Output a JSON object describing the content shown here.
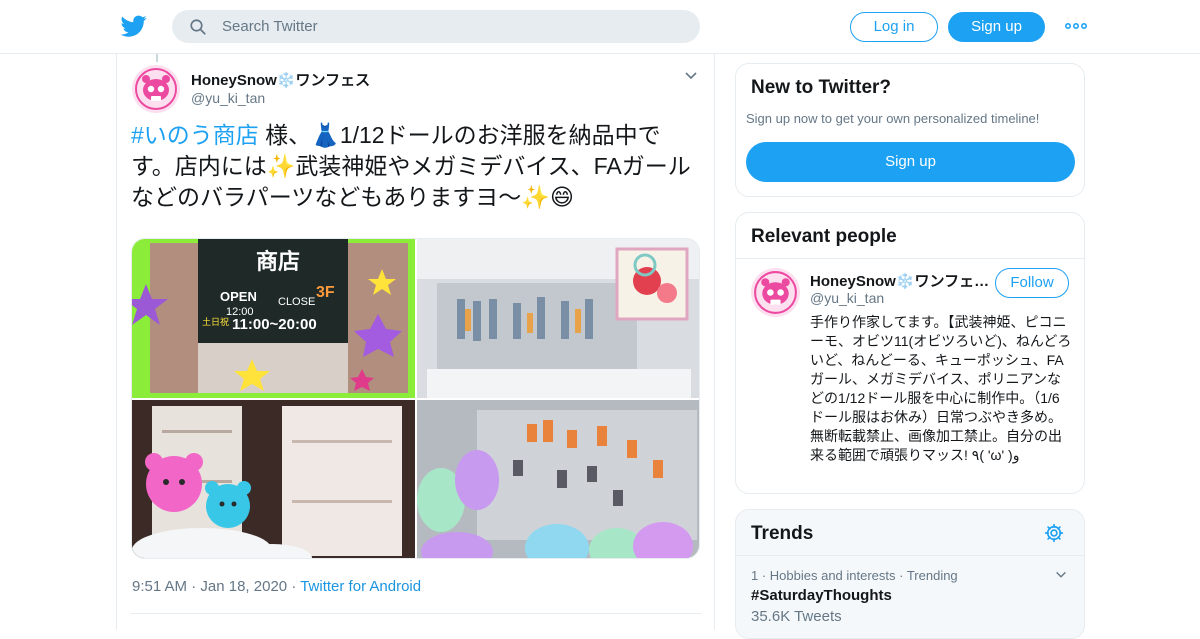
{
  "header": {
    "search_placeholder": "Search Twitter",
    "login_label": "Log in",
    "signup_label": "Sign up",
    "brand_color": "#1da1f2"
  },
  "tweet": {
    "author_name": "HoneySnow❄️ワンフェス",
    "author_handle": "@yu_ki_tan",
    "hashtag": "#いのう商店",
    "text_after_hashtag": " 様、👗1/12ドールのお洋服を納品中です。店内には✨武装神姫やメガミデバイス、FAガールなどのバラパーツなどもありますヨ〜✨😄",
    "time": "9:51 AM",
    "date": "Jan 18, 2020",
    "source": "Twitter for Android",
    "photo_sign": {
      "shop": "商店",
      "open": "OPEN",
      "open_time": "12:00",
      "close": "CLOSE",
      "floor": "3F",
      "weekend": "土日祝",
      "weekend_hours": "11:00~20:00"
    }
  },
  "new_to_twitter": {
    "title": "New to Twitter?",
    "subtitle": "Sign up now to get your own personalized timeline!",
    "signup_label": "Sign up"
  },
  "relevant_people": {
    "title": "Relevant people",
    "name": "HoneySnow❄️ワンフェ…",
    "handle": "@yu_ki_tan",
    "follow_label": "Follow",
    "bio": "手作り作家してます。【武装神姫、ピコニーモ、オビツ11(オビツろいど)、ねんどろいど、ねんどーる、キューポッシュ、FAガール、メガミデバイス、ポリニアンなどの1/12ドール服を中心に制作中。（1/6ドール服はお休み）日常つぶやき多め。無断転載禁止、画像加工禁止。自分の出来る範囲で頑張りマッス! ٩( 'ω' )و"
  },
  "trends": {
    "title": "Trends",
    "items": [
      {
        "meta": "1 · Hobbies and interests · Trending",
        "tag": "#SaturdayThoughts",
        "count": "35.6K Tweets"
      }
    ]
  }
}
